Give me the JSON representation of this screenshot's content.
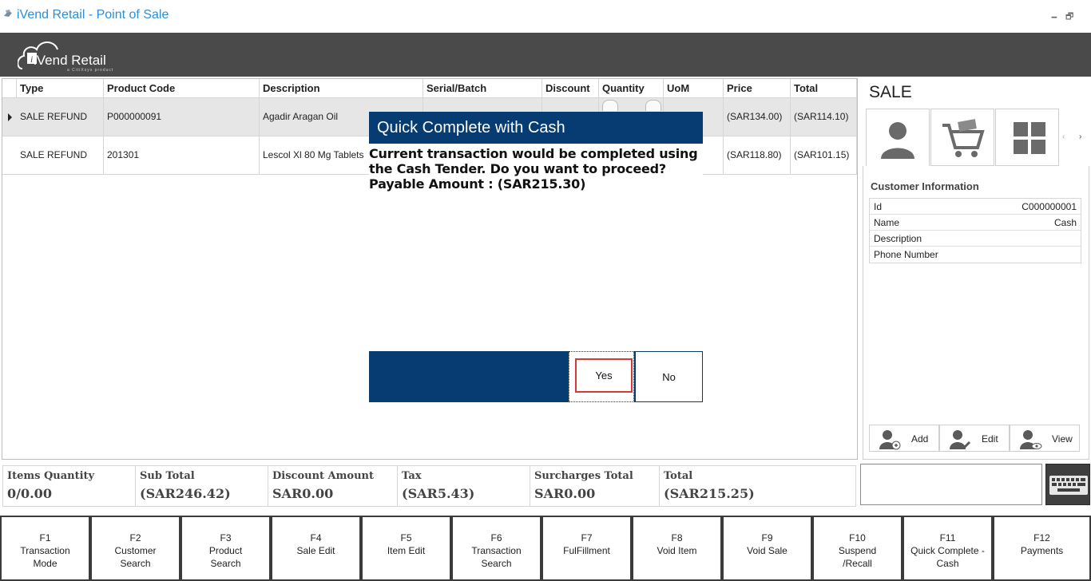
{
  "window": {
    "title": "iVend Retail - Point of Sale",
    "minimize_glyph": "🗕",
    "restore_glyph": "🗗"
  },
  "brand": {
    "name": "iVend Retail",
    "sub": "a CitiXsys product",
    "header_color": "#4a4a4a"
  },
  "grid": {
    "columns": [
      "Type",
      "Product Code",
      "Description",
      "Serial/Batch",
      "Discount",
      "Quantity",
      "UoM",
      "Price",
      "Total"
    ],
    "rows": [
      {
        "type": "SALE REFUND",
        "code": "P000000091",
        "desc": "Agadir Aragan Oil",
        "serial": "",
        "discount": "",
        "qty": "",
        "uom": "",
        "price": "(SAR134.00)",
        "total": "(SAR114.10)"
      },
      {
        "type": "SALE REFUND",
        "code": "201301",
        "desc": "Lescol Xl 80 Mg Tablets",
        "serial": "",
        "discount": "",
        "qty": "",
        "uom": "",
        "price": "(SAR118.80)",
        "total": "(SAR101.15)"
      }
    ]
  },
  "right_panel": {
    "title": "SALE",
    "tabs": [
      "customer-icon",
      "cart-icon",
      "grid-icon"
    ],
    "prev_arrow": "‹",
    "next_arrow": "›",
    "customer": {
      "heading": "Customer Information",
      "fields": [
        {
          "label": "Id",
          "value": "C000000001"
        },
        {
          "label": "Name",
          "value": "Cash"
        },
        {
          "label": "Description",
          "value": ""
        },
        {
          "label": "Phone Number",
          "value": ""
        }
      ]
    },
    "buttons": {
      "add": "Add",
      "edit": "Edit",
      "view": "View"
    }
  },
  "totals": [
    {
      "label": "Items Quantity",
      "value": "0/0.00"
    },
    {
      "label": "Sub Total",
      "value": "(SAR246.42)"
    },
    {
      "label": "Discount Amount",
      "value": "SAR0.00"
    },
    {
      "label": "Tax",
      "value": "(SAR5.43)"
    },
    {
      "label": "Surcharges Total",
      "value": "SAR0.00"
    },
    {
      "label": "Total",
      "value": "(SAR215.25)"
    }
  ],
  "scan_input": {
    "value": ""
  },
  "fkeys": [
    {
      "key": "F1",
      "l1": "Transaction",
      "l2": "Mode"
    },
    {
      "key": "F2",
      "l1": "Customer",
      "l2": "Search"
    },
    {
      "key": "F3",
      "l1": "Product",
      "l2": "Search"
    },
    {
      "key": "F4",
      "l1": "Sale Edit",
      "l2": ""
    },
    {
      "key": "F5",
      "l1": "Item Edit",
      "l2": ""
    },
    {
      "key": "F6",
      "l1": "Transaction",
      "l2": "Search"
    },
    {
      "key": "F7",
      "l1": "FulFillment",
      "l2": ""
    },
    {
      "key": "F8",
      "l1": "Void Item",
      "l2": ""
    },
    {
      "key": "F9",
      "l1": "Void Sale",
      "l2": ""
    },
    {
      "key": "F10",
      "l1": "Suspend",
      "l2": "/Recall"
    },
    {
      "key": "F11",
      "l1": "Quick Complete -",
      "l2": "Cash"
    },
    {
      "key": "F12",
      "l1": "Payments",
      "l2": ""
    }
  ],
  "dialog": {
    "title": "Quick Complete with Cash",
    "message": "Current transaction would be completed using the Cash Tender. Do you want to proceed? Payable Amount : (SAR215.30)",
    "yes": "Yes",
    "no": "No",
    "accent": "#063c72",
    "highlight": "#d23a3a"
  }
}
